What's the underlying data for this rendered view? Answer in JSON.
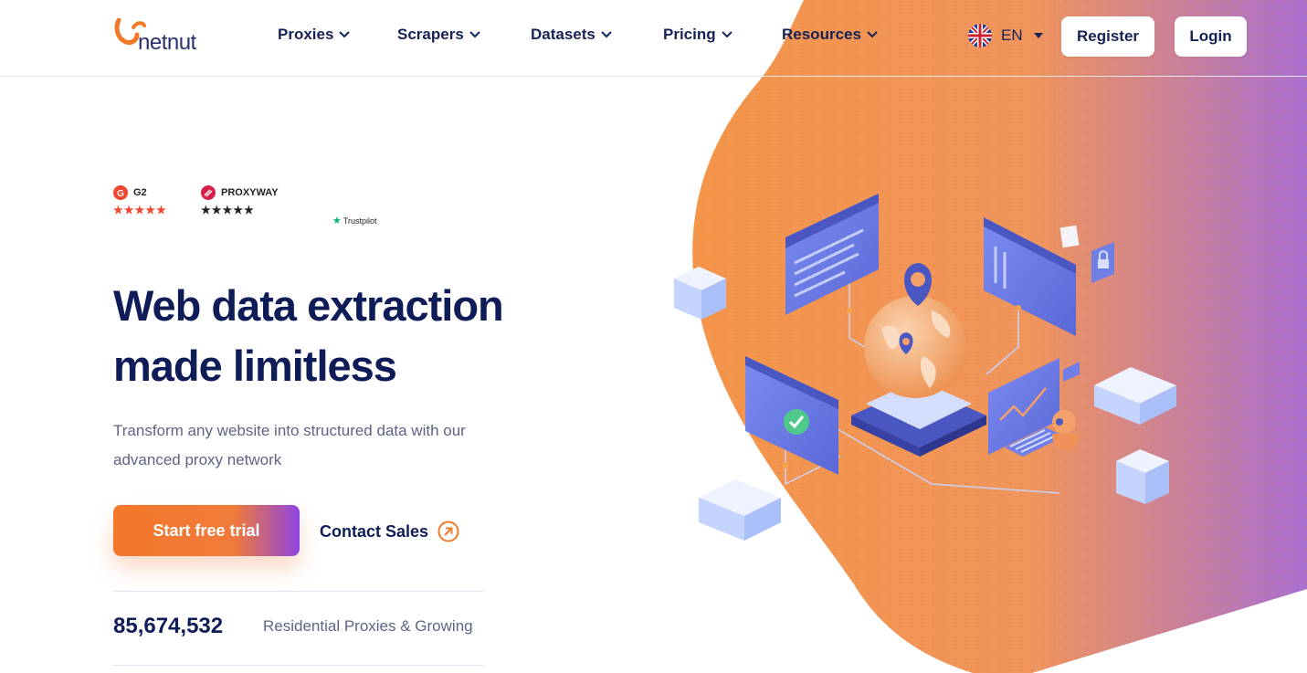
{
  "brand": {
    "name": "netnut"
  },
  "nav": {
    "items": [
      {
        "label": "Proxies"
      },
      {
        "label": "Scrapers"
      },
      {
        "label": "Datasets"
      },
      {
        "label": "Pricing"
      },
      {
        "label": "Resources"
      }
    ],
    "language": "EN",
    "register_label": "Register",
    "login_label": "Login"
  },
  "ratings": {
    "g2": {
      "label": "G2",
      "stars": "★★★★★"
    },
    "proxyway": {
      "label": "PROXYWAY",
      "stars": "★★★★★"
    },
    "trustpilot": {
      "label": "Trustpilot"
    }
  },
  "hero": {
    "title_line1": "Web data extraction",
    "title_line2": "made limitless",
    "subtitle": "Transform any website into structured data with our advanced proxy network",
    "cta_label": "Start free trial",
    "contact_label": "Contact Sales"
  },
  "stats": {
    "number": "85,674,532",
    "label": "Residential Proxies & Growing"
  },
  "colors": {
    "accent_orange": "#f4782a",
    "accent_purple": "#8e44e2",
    "navy": "#0f1c57"
  }
}
